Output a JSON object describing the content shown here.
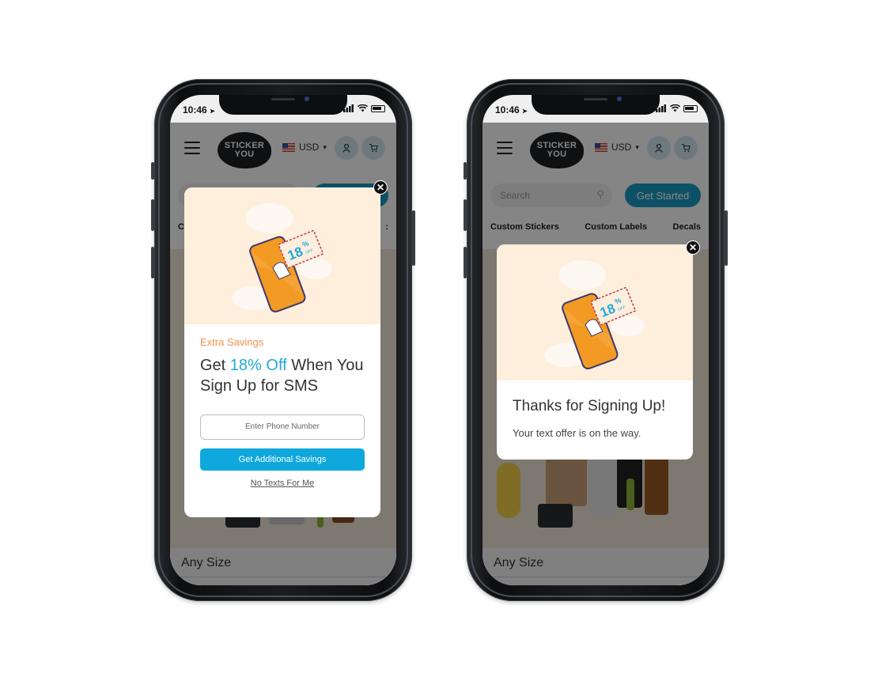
{
  "status_bar": {
    "time": "10:46",
    "location_arrow": "➤",
    "signal_icon": "signal-bars",
    "wifi_icon": "wifi",
    "battery_icon": "battery"
  },
  "header": {
    "logo_line1": "STICKER",
    "logo_line2": "YOU",
    "currency": "USD",
    "currency_caret": "⌄",
    "account_icon": "person-icon",
    "cart_icon": "cart-icon"
  },
  "search": {
    "placeholder": "Search",
    "cta_label": "Get Started"
  },
  "category_nav": [
    "Custom Stickers",
    "Custom Labels",
    "Decals"
  ],
  "hero_partial_letter": "C",
  "listing": {
    "any_size": "Any Size"
  },
  "illustration": {
    "coupon_text": "18",
    "coupon_suffix": "%",
    "coupon_off": "OFF"
  },
  "signup_modal": {
    "close_label": "✕",
    "eyebrow": "Extra Savings",
    "headline_pre": "Get ",
    "headline_accent": "18% Off",
    "headline_post": " When You Sign Up for SMS",
    "phone_placeholder": "Enter Phone Number",
    "submit_label": "Get Additional Savings",
    "decline_label": "No Texts For Me"
  },
  "thanks_modal": {
    "close_label": "✕",
    "title": "Thanks for Signing Up!",
    "subtitle": "Your text offer is on the way."
  },
  "colors": {
    "accent_blue": "#0fa8dc",
    "eyebrow_orange": "#f0944f",
    "illustration_bg": "#fdefdc",
    "cta_teal": "#1c9bc4"
  }
}
